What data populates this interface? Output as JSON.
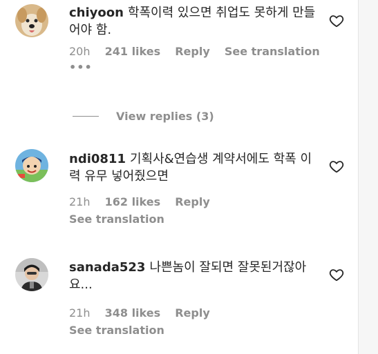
{
  "comments": [
    {
      "username": "chiyoon",
      "text": "학폭이력 있으면 취업도 못하게 만들어야 함.",
      "time": "20h",
      "likes": "241 likes",
      "reply": "Reply",
      "translation": "See translation",
      "more": "•••"
    },
    {
      "username": "ndi0811",
      "text": "기획사&연습생 계약서에도 학폭 이력 유무 넣어줬으면",
      "time": "21h",
      "likes": "162 likes",
      "reply": "Reply",
      "translation": "See translation"
    },
    {
      "username": "sanada523",
      "text": "나쁜놈이 잘되면 잘못된거잖아요...",
      "time": "21h",
      "likes": "348 likes",
      "reply": "Reply",
      "translation": "See translation"
    }
  ],
  "view_replies": "View replies (3)",
  "icons": {
    "like": "heart-icon",
    "more": "more-options-icon"
  }
}
